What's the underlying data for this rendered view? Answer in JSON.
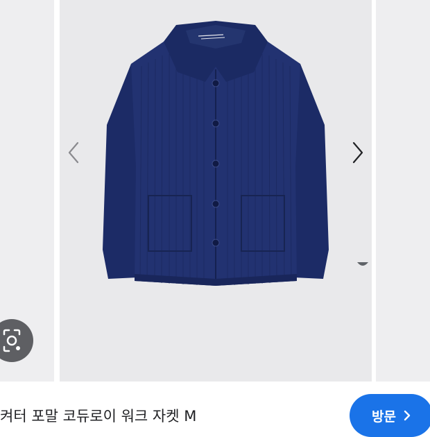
{
  "colors": {
    "panel_bg": "#eeeef0",
    "image_bg": "#e9e9eb",
    "jacket": "#1f2f6e",
    "visit_button_bg": "#1a73e8",
    "lens_button_bg": "#5e5f63",
    "title_text": "#202124"
  },
  "result": {
    "title": "켜터 포말 코듀로이 워크 자켓 M",
    "visit_label": "방문",
    "image_subject": "navy corduroy work jacket"
  },
  "icons": {
    "prev": "chevron-left-icon",
    "next": "chevron-right-icon",
    "lens": "google-lens-icon",
    "visit": "chevron-right-icon"
  }
}
